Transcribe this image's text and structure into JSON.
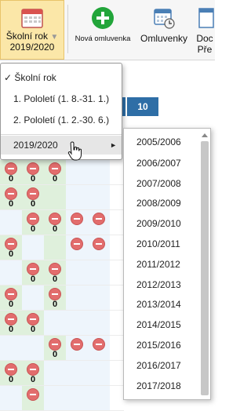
{
  "toolbar": {
    "school_year_button": {
      "line1": "Školní rok",
      "line2": "2019/2020",
      "icon": "calendar-icon"
    },
    "new_excuse_button": {
      "label": "Nová omluvenka",
      "icon": "plus-circle-icon",
      "color": "#22a53a"
    },
    "excuses_button": {
      "label": "Omluvenky",
      "icon": "calendar-clock-icon"
    },
    "doc_button": {
      "line1": "Doc",
      "line2": "Pře",
      "icon": "document-icon"
    }
  },
  "grid": {
    "header_number": "10",
    "zero": "0"
  },
  "menu": {
    "checked_mark": "✓",
    "items": [
      {
        "label": "Školní rok"
      },
      {
        "label": "1. Pololetí (1. 8.-31. 1.)"
      },
      {
        "label": "2. Pololetí (1. 2.-30. 6.)"
      }
    ],
    "year_item": {
      "label": "2019/2020",
      "arrow": "►"
    }
  },
  "year_submenu": {
    "years": [
      "2005/2006",
      "2006/2007",
      "2007/2008",
      "2008/2009",
      "2009/2010",
      "2010/2011",
      "2011/2012",
      "2012/2013",
      "2013/2014",
      "2014/2015",
      "2015/2016",
      "2016/2017",
      "2017/2018"
    ]
  },
  "colors": {
    "header_blue": "#2e6ea6",
    "active_button": "#fbe7a8",
    "absence_red": "#e26d6d",
    "present_green": "#dff0dc"
  }
}
